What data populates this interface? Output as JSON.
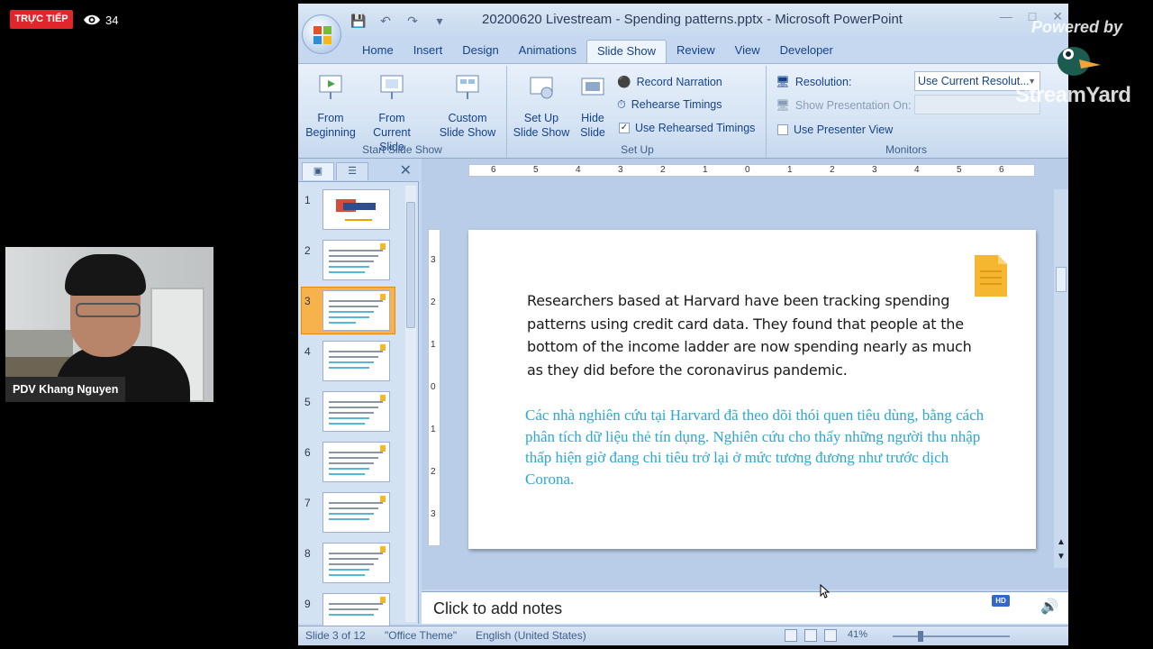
{
  "overlay": {
    "live_label": "TRỰC TIẾP",
    "viewer_count": "34",
    "presenter_name": "PDV Khang Nguyen",
    "powered_by": "Powered by",
    "brand": "StreamYard",
    "hd_label": "HD"
  },
  "window": {
    "title": "20200620 Livestream - Spending patterns.pptx - Microsoft PowerPoint",
    "tabs": [
      "Home",
      "Insert",
      "Design",
      "Animations",
      "Slide Show",
      "Review",
      "View",
      "Developer"
    ],
    "active_tab": "Slide Show"
  },
  "ribbon": {
    "start_group": {
      "label": "Start Slide Show",
      "from_beginning": [
        "From",
        "Beginning"
      ],
      "from_current": [
        "From",
        "Current Slide"
      ],
      "custom": [
        "Custom",
        "Slide Show"
      ]
    },
    "setup_group": {
      "label": "Set Up",
      "setup_show": [
        "Set Up",
        "Slide Show"
      ],
      "hide_slide": [
        "Hide",
        "Slide"
      ],
      "record_narration": "Record Narration",
      "rehearse_timings": "Rehearse Timings",
      "use_rehearsed": "Use Rehearsed Timings"
    },
    "monitors_group": {
      "label": "Monitors",
      "resolution_label": "Resolution:",
      "resolution_value": "Use Current Resolut...",
      "show_on_label": "Show Presentation On:",
      "presenter_view": "Use Presenter View"
    }
  },
  "thumbnails": [
    "1",
    "2",
    "3",
    "4",
    "5",
    "6",
    "7",
    "8",
    "9"
  ],
  "selected_slide": 3,
  "slide": {
    "english": "Researchers based at Harvard have been tracking spending patterns using credit card data. They found that people at the bottom of the income ladder are now spending nearly as much as they did before the coronavirus pandemic.",
    "vietnamese": "Các nhà nghiên cứu tại Harvard đã theo dõi thói quen tiêu dùng, bằng cách phân tích dữ liệu thẻ tín dụng. Nghiên cứu cho thấy những người thu nhập thấp hiện giờ đang chi tiêu trở lại ở mức tương đương như trước dịch Corona."
  },
  "notes_placeholder": "Click to add notes",
  "status": {
    "slide_info": "Slide 3 of 12",
    "theme": "\"Office Theme\"",
    "language": "English (United States)",
    "zoom": "41%"
  },
  "ruler": {
    "h_labels": [
      "6",
      "5",
      "4",
      "3",
      "2",
      "1",
      "0",
      "1",
      "2",
      "3",
      "4",
      "5",
      "6"
    ],
    "v_labels": [
      "3",
      "2",
      "1",
      "0",
      "1",
      "2",
      "3"
    ]
  },
  "colors": {
    "live_red": "#e0262b",
    "vietnamese_text": "#2aa8cf",
    "selected_thumb": "#f7b24c"
  },
  "icons": [
    "eye-icon",
    "office-logo-icon",
    "save-icon",
    "undo-icon",
    "redo-icon",
    "slideshow-icon",
    "note-icon",
    "cursor-icon",
    "volume-icon"
  ]
}
